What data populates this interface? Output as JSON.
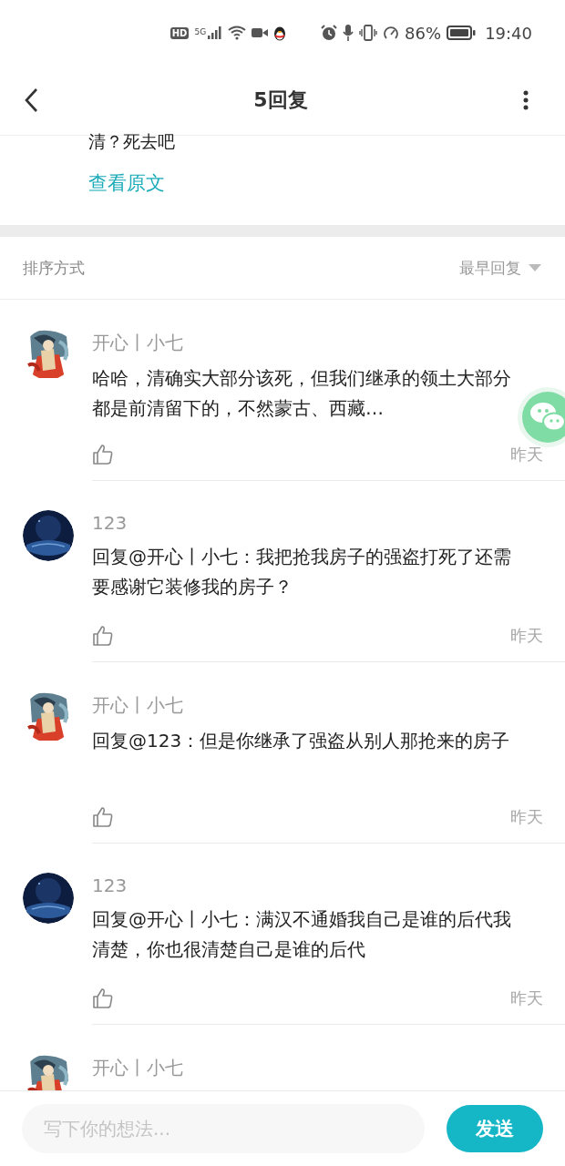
{
  "status_bar": {
    "hd": "HD",
    "network": "5G",
    "battery": "86%",
    "time": "19:40"
  },
  "header": {
    "title": "5回复"
  },
  "original": {
    "text": "清？死去吧",
    "link": "查看原文"
  },
  "sort": {
    "label": "排序方式",
    "value": "最早回复"
  },
  "comments": [
    {
      "kind": "art",
      "name": "开心丨小七",
      "text": "哈哈，清确实大部分该死，但我们继承的领土大部分都是前清留下的，不然蒙古、西藏…",
      "time": "昨天"
    },
    {
      "kind": "night",
      "name": "123",
      "text": "回复@开心丨小七：我把抢我房子的强盗打死了还需要感谢它装修我的房子？",
      "time": "昨天"
    },
    {
      "kind": "art",
      "name": "开心丨小七",
      "text": "回复@123：但是你继承了强盗从别人那抢来的房子",
      "time": "昨天"
    },
    {
      "kind": "night",
      "name": "123",
      "text": "回复@开心丨小七：满汉不通婚我自己是谁的后代我清楚，你也很清楚自己是谁的后代",
      "time": "昨天"
    },
    {
      "kind": "art",
      "name": "开心丨小七"
    }
  ],
  "input": {
    "placeholder": "写下你的想法...",
    "send": "发送"
  }
}
